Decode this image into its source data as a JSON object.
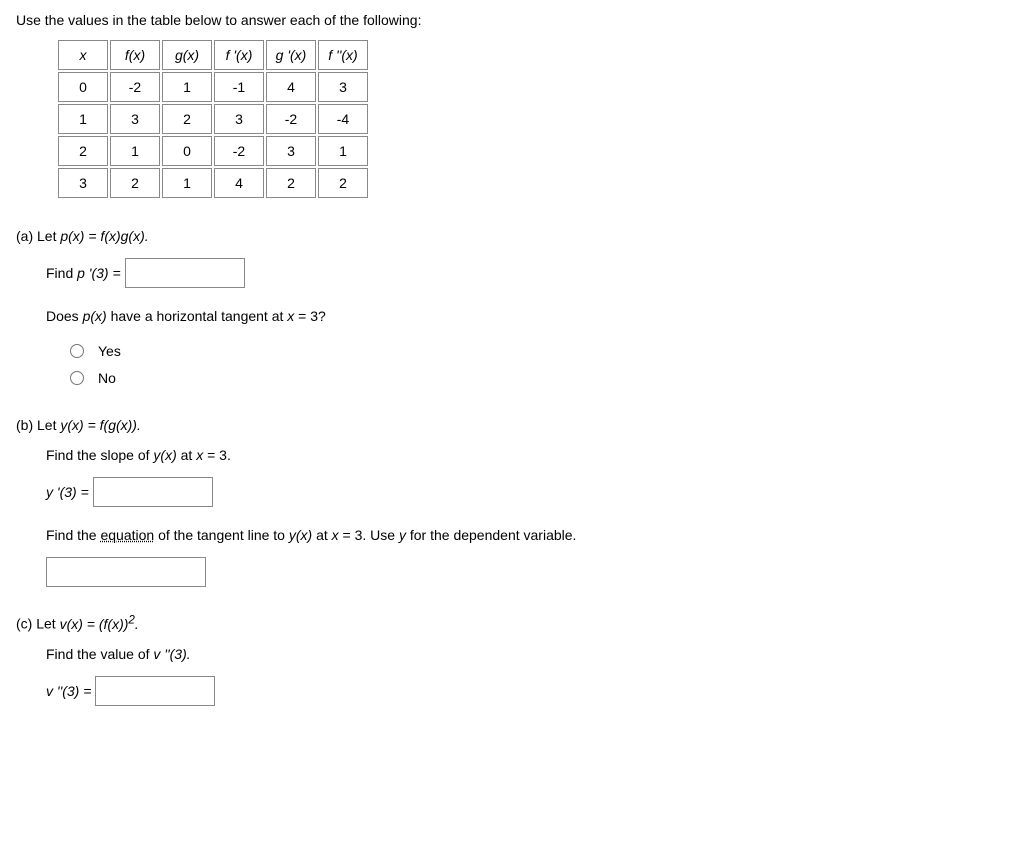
{
  "intro": "Use the values in the table below to answer each of the following:",
  "table": {
    "headers": [
      "x",
      "f(x)",
      "g(x)",
      "f '(x)",
      "g '(x)",
      "f ''(x)"
    ],
    "rows": [
      [
        "0",
        "-2",
        "1",
        "-1",
        "4",
        "3"
      ],
      [
        "1",
        "3",
        "2",
        "3",
        "-2",
        "-4"
      ],
      [
        "2",
        "1",
        "0",
        "-2",
        "3",
        "1"
      ],
      [
        "3",
        "2",
        "1",
        "4",
        "2",
        "2"
      ]
    ]
  },
  "parts": {
    "a": {
      "label_prefix": "(a) Let ",
      "definition": "p(x) = f(x)g(x).",
      "find_prefix": "Find ",
      "find_expr": "p '(3) = ",
      "tangent_q_prefix": "Does ",
      "tangent_q_mid": "p(x)",
      "tangent_q_suffix": " have a horizontal tangent at ",
      "tangent_q_var": "x",
      "tangent_q_end": " = 3?",
      "opt_yes": "Yes",
      "opt_no": "No"
    },
    "b": {
      "label_prefix": "(b) Let ",
      "definition": "y(x) = f(g(x)).",
      "slope_text_prefix": "Find the slope of ",
      "slope_text_mid": "y(x)",
      "slope_text_at": " at ",
      "slope_text_var": "x",
      "slope_text_end": " = 3.",
      "find_expr": "y '(3) = ",
      "tangent_line_prefix": "Find the ",
      "tangent_line_underlined": "equation",
      "tangent_line_mid": " of the tangent line to ",
      "tangent_line_func": "y(x)",
      "tangent_line_at": " at ",
      "tangent_line_var": "x",
      "tangent_line_eq": " = 3. Use ",
      "tangent_line_depvar": "y",
      "tangent_line_end": " for the dependent variable."
    },
    "c": {
      "label_prefix": "(c) Let ",
      "definition_pre": "v(x) = (f(x))",
      "definition_sup": "2",
      "definition_post": ".",
      "find_text_prefix": "Find the value of ",
      "find_text_expr": "v ''(3).",
      "find_expr": "v ''(3) = "
    }
  }
}
